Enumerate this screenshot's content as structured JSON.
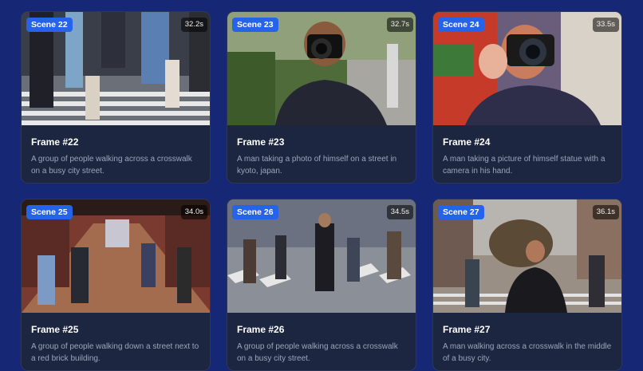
{
  "cards": [
    {
      "scene": "Scene 22",
      "duration": "32.2s",
      "title": "Frame #22",
      "caption": "A group of people walking across a crosswalk on a busy city street."
    },
    {
      "scene": "Scene 23",
      "duration": "32.7s",
      "title": "Frame #23",
      "caption": "A man taking a photo of himself on a street in kyoto, japan."
    },
    {
      "scene": "Scene 24",
      "duration": "33.5s",
      "title": "Frame #24",
      "caption": "A man taking a picture of himself statue with a camera in his hand."
    },
    {
      "scene": "Scene 25",
      "duration": "34.0s",
      "title": "Frame #25",
      "caption": "A group of people walking down a street next to a red brick building."
    },
    {
      "scene": "Scene 26",
      "duration": "34.5s",
      "title": "Frame #26",
      "caption": "A group of people walking across a crosswalk on a busy city street."
    },
    {
      "scene": "Scene 27",
      "duration": "36.1s",
      "title": "Frame #27",
      "caption": "A man walking across a crosswalk in the middle of a busy city."
    }
  ],
  "colors": {
    "page_bg": "#162776",
    "card_bg": "#1c2640",
    "scene_badge": "#2563eb"
  }
}
